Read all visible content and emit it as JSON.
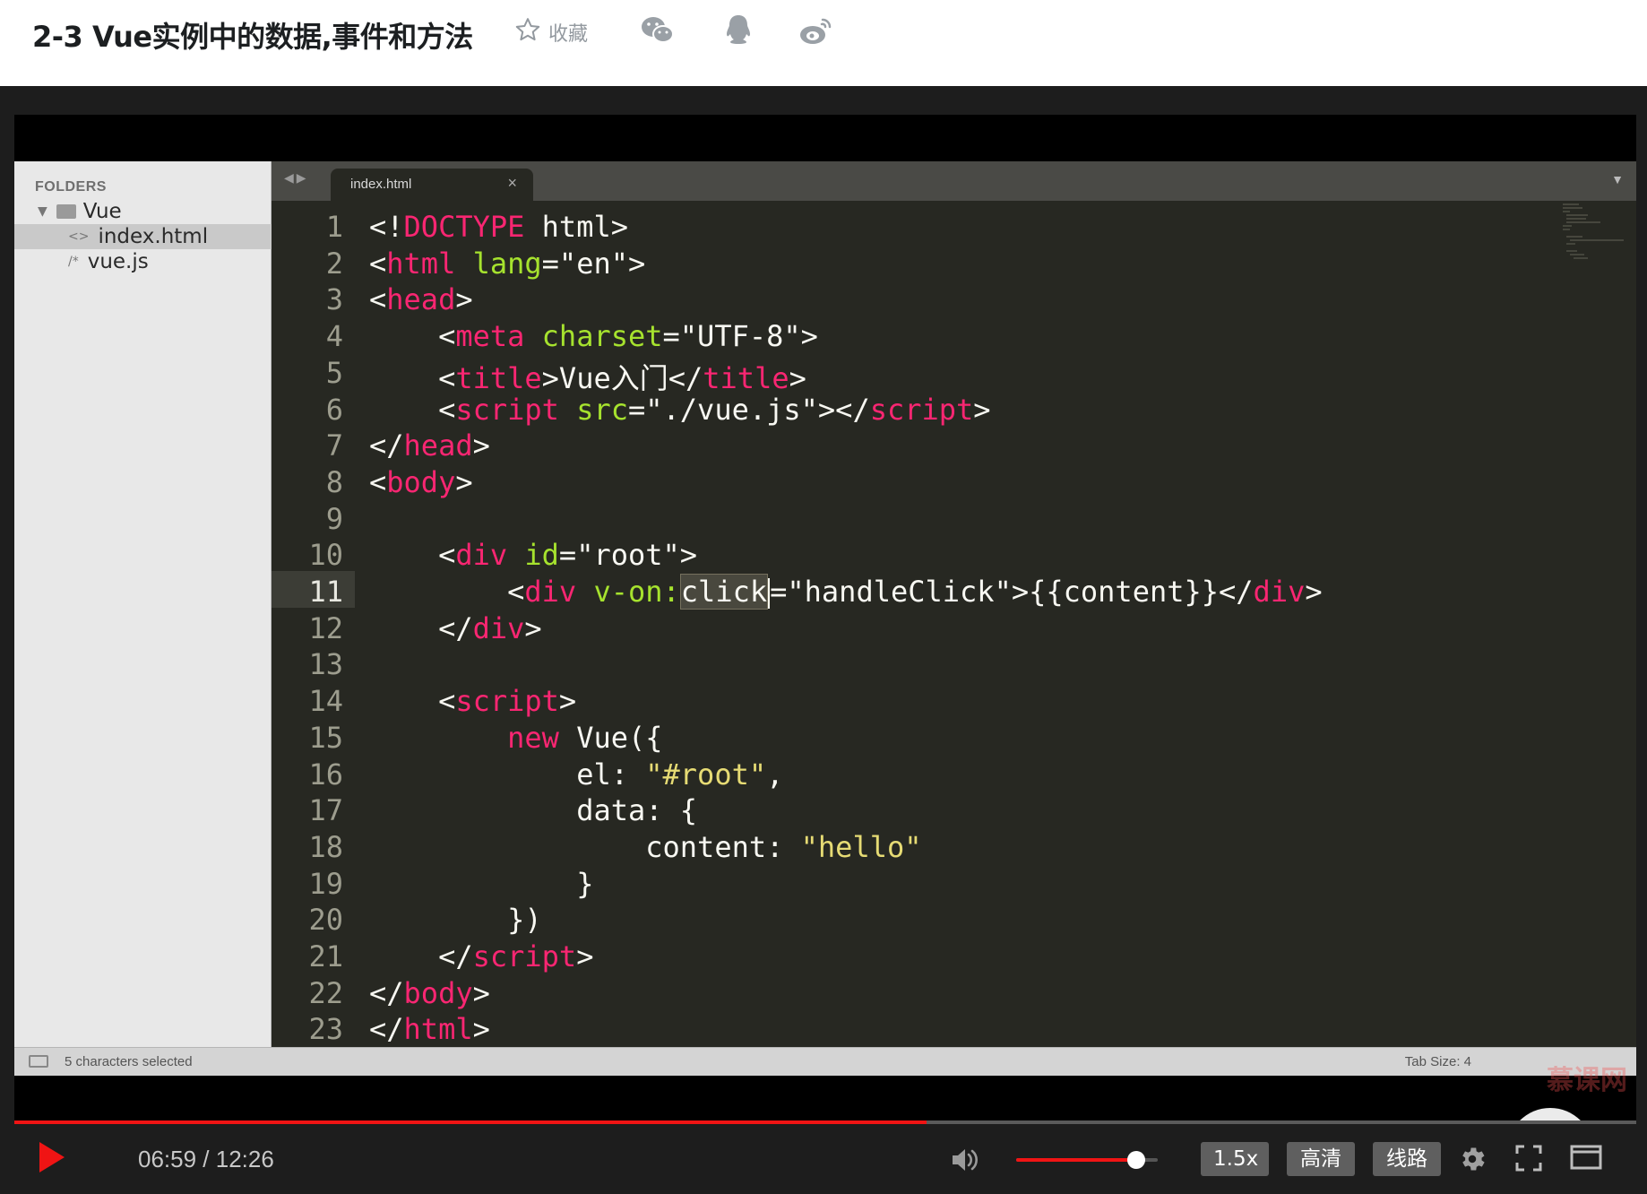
{
  "page": {
    "title": "2-3 Vue实例中的数据,事件和方法",
    "collect_label": "收藏",
    "share_icons": [
      "wechat-icon",
      "qq-icon",
      "weibo-icon"
    ]
  },
  "editor": {
    "sidebar": {
      "heading": "FOLDERS",
      "folder": "Vue",
      "files": [
        {
          "glyph": "<>",
          "name": "index.html",
          "selected": true
        },
        {
          "glyph": "/*",
          "name": "vue.js",
          "selected": false
        }
      ]
    },
    "tab": {
      "label": "index.html",
      "close": "×"
    },
    "active_line": 11,
    "lines": [
      [
        [
          "t",
          "<!"
        ],
        [
          "k",
          "DOCTYPE"
        ],
        [
          "t",
          " html>"
        ]
      ],
      [
        [
          "t",
          "<"
        ],
        [
          "k",
          "html"
        ],
        [
          "t",
          " "
        ],
        [
          "a",
          "lang"
        ],
        [
          "t",
          "=\"en\">"
        ]
      ],
      [
        [
          "t",
          "<"
        ],
        [
          "k",
          "head"
        ],
        [
          "t",
          ">"
        ]
      ],
      [
        [
          "t",
          "    <"
        ],
        [
          "k",
          "meta"
        ],
        [
          "t",
          " "
        ],
        [
          "a",
          "charset"
        ],
        [
          "t",
          "=\"UTF-8\">"
        ]
      ],
      [
        [
          "t",
          "    <"
        ],
        [
          "k",
          "title"
        ],
        [
          "t",
          ">Vue入门</"
        ],
        [
          "k",
          "title"
        ],
        [
          "t",
          ">"
        ]
      ],
      [
        [
          "t",
          "    <"
        ],
        [
          "k",
          "script"
        ],
        [
          "t",
          " "
        ],
        [
          "a",
          "src"
        ],
        [
          "t",
          "=\"./vue.js\"></"
        ],
        [
          "k",
          "script"
        ],
        [
          "t",
          ">"
        ]
      ],
      [
        [
          "t",
          "</"
        ],
        [
          "k",
          "head"
        ],
        [
          "t",
          ">"
        ]
      ],
      [
        [
          "t",
          "<"
        ],
        [
          "k",
          "body"
        ],
        [
          "t",
          ">"
        ]
      ],
      [],
      [
        [
          "t",
          "    <"
        ],
        [
          "k",
          "div"
        ],
        [
          "t",
          " "
        ],
        [
          "a",
          "id"
        ],
        [
          "t",
          "=\"root\">"
        ]
      ],
      [
        [
          "t",
          "        <"
        ],
        [
          "k",
          "div"
        ],
        [
          "t",
          " "
        ],
        [
          "a",
          "v-on:"
        ],
        [
          "sel",
          "click"
        ],
        [
          "cur",
          ""
        ],
        [
          "t",
          "=\"handleClick\">{{content}}</"
        ],
        [
          "k",
          "div"
        ],
        [
          "t",
          ">"
        ]
      ],
      [
        [
          "t",
          "    </"
        ],
        [
          "k",
          "div"
        ],
        [
          "t",
          ">"
        ]
      ],
      [],
      [
        [
          "t",
          "    <"
        ],
        [
          "k",
          "script"
        ],
        [
          "t",
          ">"
        ]
      ],
      [
        [
          "t",
          "        "
        ],
        [
          "kw",
          "new"
        ],
        [
          "t",
          " Vue({"
        ]
      ],
      [
        [
          "t",
          "            el: "
        ],
        [
          "s",
          "\"#root\""
        ],
        [
          "t",
          ","
        ]
      ],
      [
        [
          "t",
          "            data: {"
        ]
      ],
      [
        [
          "t",
          "                content: "
        ],
        [
          "s",
          "\"hello\""
        ]
      ],
      [
        [
          "t",
          "            }"
        ]
      ],
      [
        [
          "t",
          "        })"
        ]
      ],
      [
        [
          "t",
          "    </"
        ],
        [
          "k",
          "script"
        ],
        [
          "t",
          ">"
        ]
      ],
      [
        [
          "t",
          "</"
        ],
        [
          "k",
          "body"
        ],
        [
          "t",
          ">"
        ]
      ],
      [
        [
          "t",
          "</"
        ],
        [
          "k",
          "html"
        ],
        [
          "t",
          ">"
        ]
      ]
    ],
    "status": {
      "selection": "5 characters selected",
      "tab_size": "Tab Size: 4"
    },
    "watermark": "慕课网"
  },
  "player": {
    "current_time": "06:59",
    "duration": "12:26",
    "time_display": "06:59 / 12:26",
    "progress_fraction": 0.5622,
    "buffered_fraction": 0.5135,
    "volume_fraction": 0.85,
    "speed_label": "1.5x",
    "quality_label": "高清",
    "route_label": "线路",
    "accent_color": "#f01414"
  }
}
